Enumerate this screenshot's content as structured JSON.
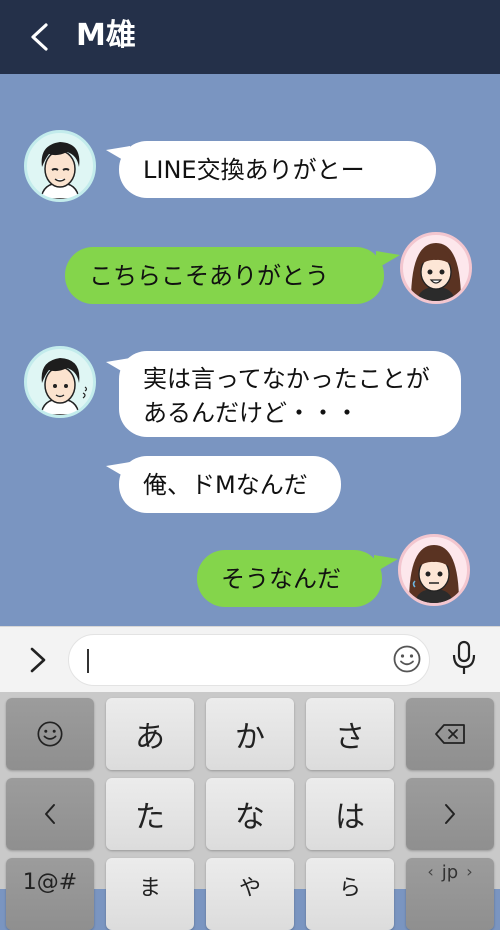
{
  "header": {
    "title": "M雄"
  },
  "messages": [
    {
      "side": "left",
      "text": "LINE交換ありがとー"
    },
    {
      "side": "right",
      "text": "こちらこそありがとう"
    },
    {
      "side": "left",
      "lines": [
        "実は言ってなかったことが",
        "あるんだけど・・・"
      ]
    },
    {
      "side": "left",
      "text": "俺、ドMなんだ"
    },
    {
      "side": "right",
      "text": "そうなんだ"
    }
  ],
  "input": {
    "value": ""
  },
  "keyboard": {
    "row1": [
      "あ",
      "か",
      "さ"
    ],
    "row2": [
      "た",
      "な",
      "は"
    ],
    "row3": [
      "ま",
      "や",
      "ら"
    ],
    "bottom_left": "1@#",
    "lang": "jp"
  },
  "colors": {
    "header": "#243049",
    "chat_bg": "#7a95c1",
    "sent": "#84d54b",
    "received": "#ffffff"
  }
}
